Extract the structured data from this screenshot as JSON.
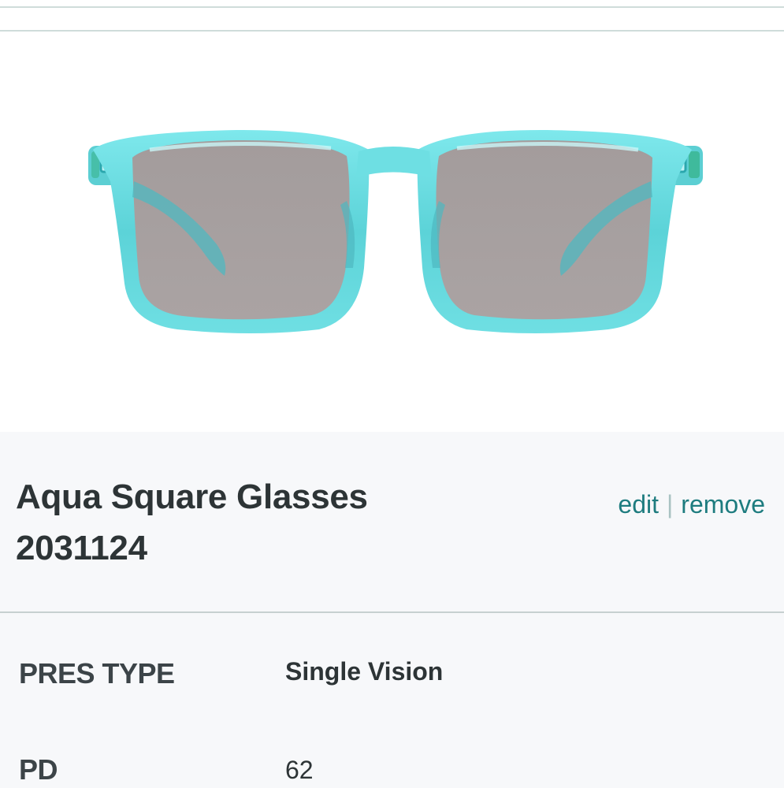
{
  "product": {
    "name": "Aqua Square Glasses",
    "sku": "2031124",
    "frame_color": "#6fe0e4",
    "lens_color": "#a6a0a0"
  },
  "actions": {
    "edit_label": "edit",
    "separator": "|",
    "remove_label": "remove",
    "link_color": "#1e7c7f"
  },
  "prescription": {
    "rows": [
      {
        "label": "PRES TYPE",
        "value": "Single Vision"
      },
      {
        "label": "PD",
        "value": "62"
      }
    ]
  }
}
